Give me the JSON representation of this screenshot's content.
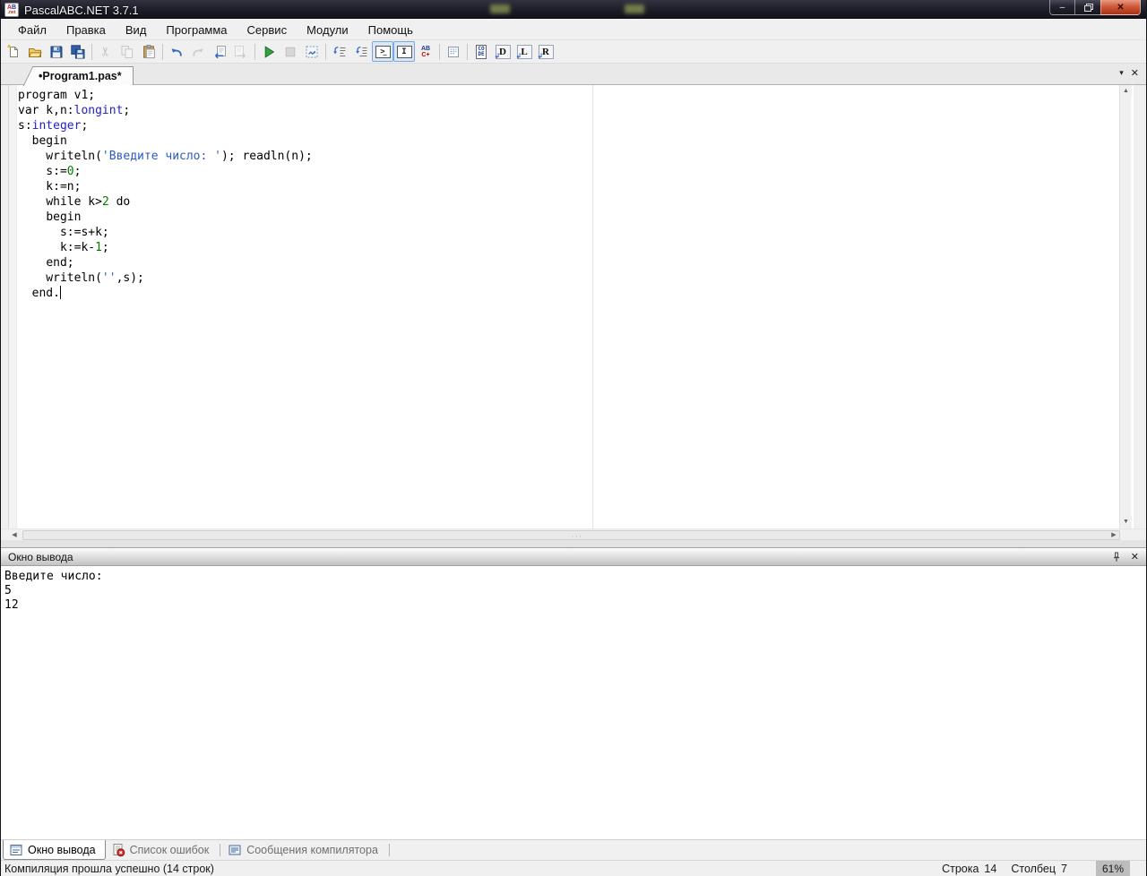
{
  "window": {
    "title": "PascalABC.NET 3.7.1",
    "minimize_glyph": "–",
    "close_glyph": "✕"
  },
  "menu": {
    "items": [
      "Файл",
      "Правка",
      "Вид",
      "Программа",
      "Сервис",
      "Модули",
      "Помощь"
    ]
  },
  "toolbar": {
    "buttons": [
      {
        "name": "new-file"
      },
      {
        "name": "open-file"
      },
      {
        "name": "save-file"
      },
      {
        "name": "save-all"
      },
      {
        "sep": true
      },
      {
        "name": "cut",
        "disabled": true
      },
      {
        "name": "copy",
        "disabled": true
      },
      {
        "name": "paste"
      },
      {
        "sep": true
      },
      {
        "name": "undo"
      },
      {
        "name": "redo",
        "disabled": true
      },
      {
        "name": "nav-back"
      },
      {
        "name": "nav-forward",
        "disabled": true
      },
      {
        "sep": true
      },
      {
        "name": "run"
      },
      {
        "name": "stop",
        "disabled": true
      },
      {
        "name": "run-without-connection"
      },
      {
        "sep": true
      },
      {
        "name": "format-code"
      },
      {
        "name": "auto-indent"
      },
      {
        "name": "console-window-toggle",
        "toggled": true,
        "text": ">"
      },
      {
        "name": "ibeam-toggle",
        "toggled": true,
        "text": "I"
      },
      {
        "name": "code-completion",
        "text_top": "AB",
        "text_bottom": "C+"
      },
      {
        "sep": true
      },
      {
        "name": "form-designer"
      },
      {
        "sep": true
      },
      {
        "name": "code-templates",
        "text_top": "CO",
        "text_bottom": "DE"
      },
      {
        "name": "disassembly-d",
        "text": "D"
      },
      {
        "name": "disassembly-l",
        "text": "L"
      },
      {
        "name": "disassembly-r",
        "text": "R"
      }
    ]
  },
  "document_tabs": {
    "active_label": "•Program1.pas*",
    "dropdown_glyph": "▾",
    "close_glyph": "✕"
  },
  "editor": {
    "lines": [
      [
        [
          "k",
          "program"
        ],
        [
          "p",
          " v1;"
        ]
      ],
      [
        [
          "k",
          "var"
        ],
        [
          "p",
          " k,n:"
        ],
        [
          "t",
          "longint"
        ],
        [
          "p",
          ";"
        ]
      ],
      [
        [
          "p",
          "s:"
        ],
        [
          "t",
          "integer"
        ],
        [
          "p",
          ";"
        ]
      ],
      [
        [
          "p",
          "  "
        ],
        [
          "k",
          "begin"
        ]
      ],
      [
        [
          "p",
          "    writeln("
        ],
        [
          "s",
          "'Введите число: '"
        ],
        [
          "p",
          "); readln(n);"
        ]
      ],
      [
        [
          "p",
          "    s:="
        ],
        [
          "n",
          "0"
        ],
        [
          "p",
          ";"
        ]
      ],
      [
        [
          "p",
          "    k:=n;"
        ]
      ],
      [
        [
          "p",
          "    "
        ],
        [
          "k",
          "while"
        ],
        [
          "p",
          " k>"
        ],
        [
          "n",
          "2"
        ],
        [
          "p",
          " "
        ],
        [
          "k",
          "do"
        ]
      ],
      [
        [
          "p",
          "    "
        ],
        [
          "k",
          "begin"
        ]
      ],
      [
        [
          "p",
          "      s:=s+k;"
        ]
      ],
      [
        [
          "p",
          "      k:=k-"
        ],
        [
          "n",
          "1"
        ],
        [
          "p",
          ";"
        ]
      ],
      [
        [
          "p",
          "    "
        ],
        [
          "k",
          "end"
        ],
        [
          "p",
          ";"
        ]
      ],
      [
        [
          "p",
          "    writeln("
        ],
        [
          "s",
          "''"
        ],
        [
          "p",
          ",s);"
        ]
      ],
      [
        [
          "p",
          "  "
        ],
        [
          "k",
          "end"
        ],
        [
          "p",
          "."
        ]
      ]
    ],
    "scroll_up_glyph": "▲",
    "scroll_down_glyph": "▼",
    "scroll_left_glyph": "◀",
    "scroll_right_glyph": "▶"
  },
  "output_panel": {
    "title": "Окно вывода",
    "close_glyph": "✕",
    "lines": [
      "Введите число:",
      "5",
      "12"
    ]
  },
  "panel_tabs": [
    {
      "label": "Окно вывода",
      "active": true
    },
    {
      "label": "Список ошибок",
      "active": false
    },
    {
      "label": "Сообщения компилятора",
      "active": false
    }
  ],
  "status_bar": {
    "message": "Компиляция прошла успешно (14 строк)",
    "line_label": "Строка",
    "line_value": "14",
    "column_label": "Столбец",
    "column_value": "7",
    "zoom": "61%"
  },
  "colors": {
    "type_blue": "#2121c8",
    "string_blue": "#2e5bbf",
    "number_green": "#007d00",
    "run_green": "#35a145",
    "error_red": "#d03030",
    "titlebar_dark": "#1b1b26"
  }
}
